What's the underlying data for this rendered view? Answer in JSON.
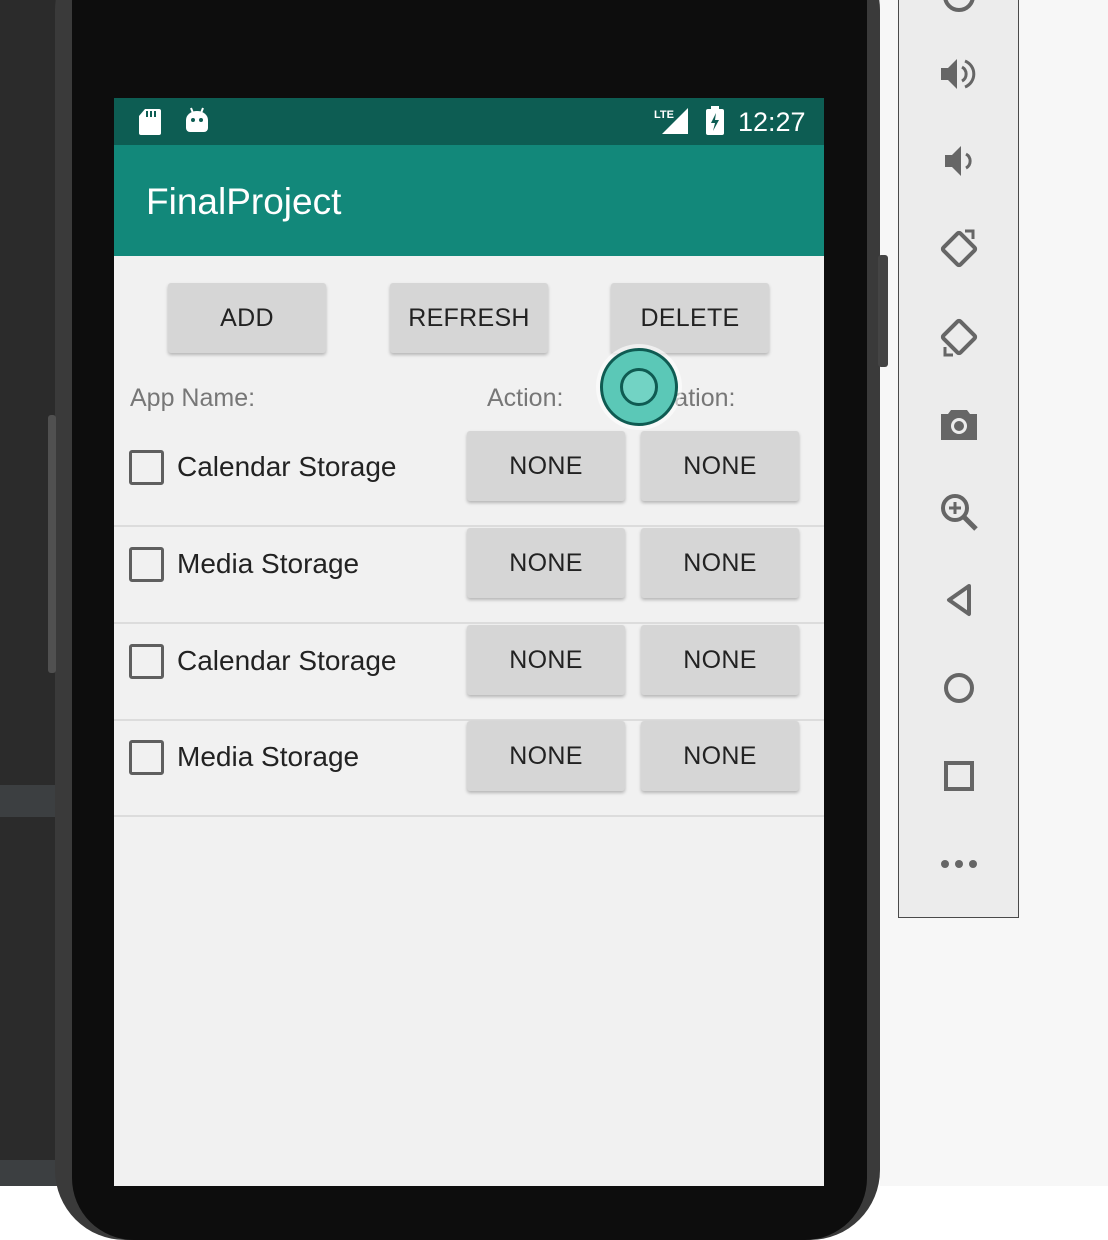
{
  "status_bar": {
    "time": "12:27",
    "network_label": "LTE",
    "icons": [
      "sd-card-icon",
      "android-debug-icon",
      "lte-signal-icon",
      "battery-charging-icon"
    ]
  },
  "app_bar": {
    "title": "FinalProject"
  },
  "toolbar_buttons": {
    "add": "ADD",
    "refresh": "REFRESH",
    "delete": "DELETE"
  },
  "columns": {
    "app_name": "App Name:",
    "action": "Action:",
    "location": "Location:"
  },
  "rows": [
    {
      "label": "Calendar Storage",
      "action": "NONE",
      "location": "NONE",
      "checked": false
    },
    {
      "label": "Media Storage",
      "action": "NONE",
      "location": "NONE",
      "checked": false
    },
    {
      "label": "Calendar Storage",
      "action": "NONE",
      "location": "NONE",
      "checked": false
    },
    {
      "label": "Media Storage",
      "action": "NONE",
      "location": "NONE",
      "checked": false
    }
  ],
  "emulator_controls": [
    "power-icon",
    "volume-up-icon",
    "volume-down-icon",
    "rotate-left-icon",
    "rotate-right-icon",
    "camera-icon",
    "zoom-icon",
    "back-icon",
    "home-icon",
    "overview-icon",
    "more-icon"
  ],
  "colors": {
    "status_bar": "#0d5d53",
    "app_bar": "#12887a",
    "button": "#d6d6d6",
    "touch_indicator": "#5bc8b7"
  }
}
